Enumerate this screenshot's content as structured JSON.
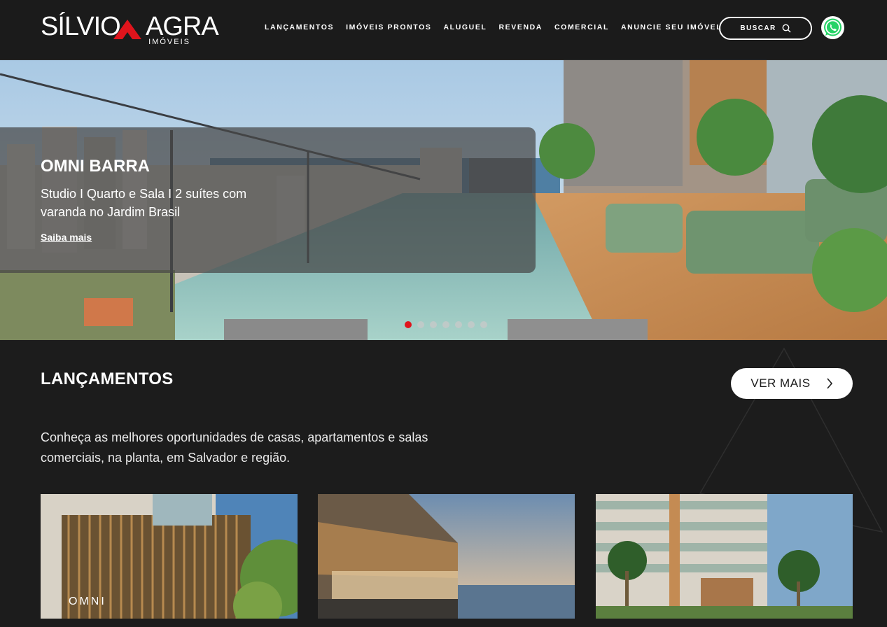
{
  "header": {
    "logo_left": "SÍLVIO",
    "logo_right": "AGRA",
    "logo_sub": "IMÓVEIS",
    "nav": [
      "LANÇAMENTOS",
      "IMÓVEIS PRONTOS",
      "ALUGUEL",
      "REVENDA",
      "COMERCIAL",
      "ANUNCIE SEU IMÓVEL"
    ],
    "search_label": "BUSCAR",
    "search_icon": "search-icon",
    "whatsapp_icon": "whatsapp-icon"
  },
  "hero": {
    "title": "OMNI BARRA",
    "subtitle": "Studio I Quarto e Sala I 2 suítes com varanda no Jardim Brasil",
    "link": "Saiba mais",
    "slides_total": 7,
    "active_slide": 1
  },
  "section": {
    "title": "LANÇAMENTOS",
    "button": "VER MAIS",
    "description": "Conheça as melhores oportunidades de casas, apartamentos e salas comerciais, na planta, em Salvador e região."
  },
  "cards": [
    {
      "logo_text": "OMNI"
    },
    {
      "logo_text": ""
    },
    {
      "logo_text": ""
    }
  ],
  "colors": {
    "accent": "#e0141c",
    "background": "#1c1c1c"
  }
}
